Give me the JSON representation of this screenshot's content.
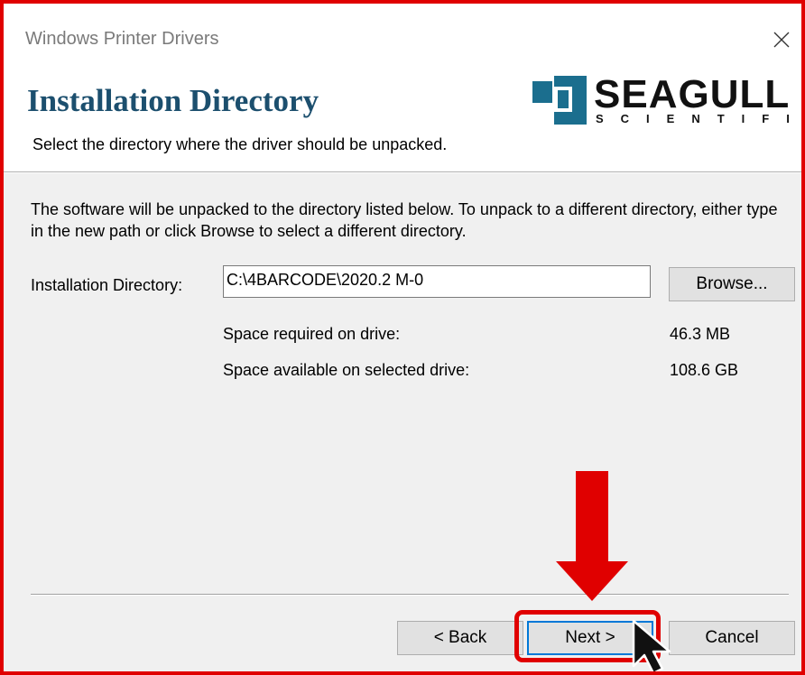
{
  "window": {
    "title": "Windows Printer Drivers",
    "close_icon": "close-icon"
  },
  "header": {
    "heading": "Installation Directory",
    "subheading": "Select the directory where the driver should be unpacked.",
    "logo_main": "SEAGULL",
    "logo_sub": "SCIENTIFIC"
  },
  "body": {
    "description": "The software will be unpacked to the directory listed below.  To unpack to a different directory, either type in the new path or click Browse to select a different directory.",
    "directory_label": "Installation Directory:",
    "directory_value": "C:\\4BARCODE\\2020.2 M-0",
    "browse_label": "Browse...",
    "space_required_label": "Space required on drive:",
    "space_required_value": "46.3 MB",
    "space_available_label": "Space available on selected drive:",
    "space_available_value": "108.6 GB"
  },
  "footer": {
    "back_label": "< Back",
    "next_label": "Next >",
    "cancel_label": "Cancel"
  },
  "annotations": {
    "highlight_color": "#e00000",
    "arrow_icon": "down-arrow-icon",
    "cursor_icon": "mouse-pointer-icon"
  }
}
